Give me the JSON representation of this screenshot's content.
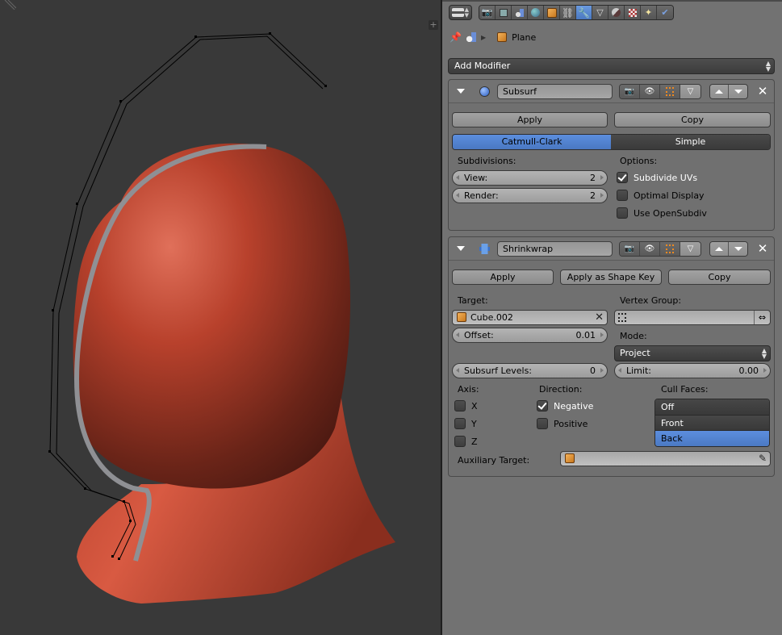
{
  "viewport": {
    "name": "3D Viewport",
    "plus_label": "+",
    "mesh_color": "#c0452e",
    "background": "#393939"
  },
  "header": {
    "editor_type_icon": "properties-editor-icon",
    "context_tabs": [
      {
        "name": "render",
        "icon": "camera-icon",
        "active": false
      },
      {
        "name": "render-layers",
        "icon": "render-layers-icon",
        "active": false
      },
      {
        "name": "scene",
        "icon": "scene-icon",
        "active": false
      },
      {
        "name": "world",
        "icon": "world-icon",
        "active": false
      },
      {
        "name": "object",
        "icon": "cube-icon",
        "active": false
      },
      {
        "name": "constraints",
        "icon": "link-icon",
        "active": false
      },
      {
        "name": "modifiers",
        "icon": "wrench-icon",
        "active": true
      },
      {
        "name": "data",
        "icon": "mesh-data-icon",
        "active": false
      },
      {
        "name": "material",
        "icon": "material-icon",
        "active": false
      },
      {
        "name": "texture",
        "icon": "texture-icon",
        "active": false
      },
      {
        "name": "particles",
        "icon": "particles-icon",
        "active": false
      },
      {
        "name": "physics",
        "icon": "physics-icon",
        "active": false
      }
    ]
  },
  "breadcrumb": {
    "pin_icon": "pin-icon",
    "scene_icon": "scene-icon",
    "object_name": "Plane"
  },
  "add_modifier": {
    "label": "Add Modifier"
  },
  "modifiers": {
    "subsurf": {
      "name": "Subsurf",
      "icon": "subsurf-icon",
      "apply_label": "Apply",
      "copy_label": "Copy",
      "type_options": [
        "Catmull-Clark",
        "Simple"
      ],
      "type_selected": "Catmull-Clark",
      "subdivisions_label": "Subdivisions:",
      "view_label": "View:",
      "view_value": "2",
      "render_label": "Render:",
      "render_value": "2",
      "options_label": "Options:",
      "options": [
        {
          "label": "Subdivide UVs",
          "checked": true
        },
        {
          "label": "Optimal Display",
          "checked": false
        },
        {
          "label": "Use OpenSubdiv",
          "checked": false
        }
      ]
    },
    "shrinkwrap": {
      "name": "Shrinkwrap",
      "icon": "shrinkwrap-icon",
      "apply_label": "Apply",
      "apply_shape_label": "Apply as Shape Key",
      "copy_label": "Copy",
      "target_label": "Target:",
      "target_value": "Cube.002",
      "vertex_group_label": "Vertex Group:",
      "vertex_group_value": "",
      "offset_label": "Offset:",
      "offset_value": "0.01",
      "mode_label": "Mode:",
      "mode_value": "Project",
      "subsurf_levels_label": "Subsurf Levels:",
      "subsurf_levels_value": "0",
      "limit_label": "Limit:",
      "limit_value": "0.00",
      "axis_label": "Axis:",
      "axes": [
        {
          "label": "X",
          "checked": false
        },
        {
          "label": "Y",
          "checked": false
        },
        {
          "label": "Z",
          "checked": false
        }
      ],
      "direction_label": "Direction:",
      "directions": [
        {
          "label": "Negative",
          "checked": true
        },
        {
          "label": "Positive",
          "checked": false
        }
      ],
      "cull_faces_label": "Cull Faces:",
      "cull_faces_options": [
        "Off",
        "Front",
        "Back"
      ],
      "cull_faces_selected": "Back",
      "aux_target_label": "Auxiliary Target:",
      "aux_target_value": ""
    }
  },
  "colors": {
    "accent": "#5680c2",
    "panel_bg": "#727272"
  }
}
